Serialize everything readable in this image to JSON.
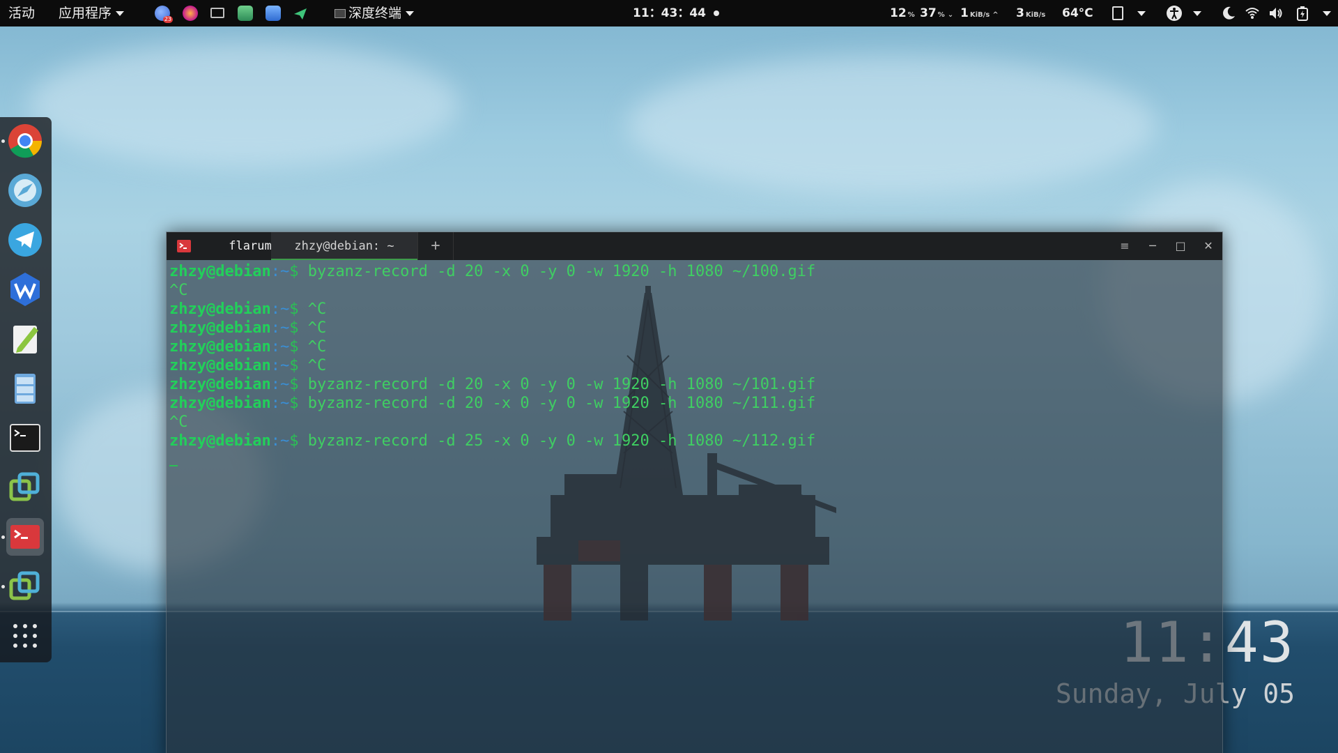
{
  "topbar": {
    "activities": "活动",
    "applications": "应用程序",
    "active_app": "深度终端",
    "clock": "11：43：44",
    "cpu": "12",
    "mem": "37",
    "percent": "%",
    "net_down": "1",
    "net_up": "3",
    "speed_unit": "KiB/s",
    "temp": "64°C",
    "badge_count": "23"
  },
  "dock": {
    "items": [
      {
        "name": "chrome",
        "running": true
      },
      {
        "name": "browser",
        "running": false
      },
      {
        "name": "telegram",
        "running": false
      },
      {
        "name": "wps",
        "running": false
      },
      {
        "name": "text-editor",
        "running": false
      },
      {
        "name": "file-manager",
        "running": false
      },
      {
        "name": "terminal",
        "running": false
      },
      {
        "name": "vmware-1",
        "running": false
      },
      {
        "name": "deepin-terminal",
        "running": true
      },
      {
        "name": "vmware-2",
        "running": true
      },
      {
        "name": "app-grid",
        "running": false
      }
    ],
    "colors": {
      "chrome_red": "#db4437",
      "chrome_green": "#0f9d58",
      "chrome_yellow": "#f4b400",
      "chrome_blue": "#4285f4",
      "telegram": "#3aa6e0",
      "wps": "#2e6fd9",
      "vmware": "#8bc34a",
      "deepin_terminal": "#d9383c"
    }
  },
  "terminal": {
    "tabs": [
      {
        "label": "flarum",
        "active": false
      },
      {
        "label": "zhzy@debian: ~",
        "active": true
      }
    ],
    "new_tab": "+",
    "controls": {
      "menu": "≡",
      "minimize": "─",
      "maximize": "□",
      "close": "✕"
    },
    "lines": [
      {
        "user": "zhzy@debian",
        "path": ":~",
        "symbol": "$ ",
        "command": "byzanz-record -d 20 -x 0 -y 0 -w 1920 -h 1080 ~/100.gif"
      },
      {
        "text": "^C"
      },
      {
        "user": "zhzy@debian",
        "path": ":~",
        "symbol": "$ ",
        "command": "^C"
      },
      {
        "user": "zhzy@debian",
        "path": ":~",
        "symbol": "$ ",
        "command": "^C"
      },
      {
        "user": "zhzy@debian",
        "path": ":~",
        "symbol": "$ ",
        "command": "^C"
      },
      {
        "user": "zhzy@debian",
        "path": ":~",
        "symbol": "$ ",
        "command": "^C"
      },
      {
        "user": "zhzy@debian",
        "path": ":~",
        "symbol": "$ ",
        "command": "byzanz-record -d 20 -x 0 -y 0 -w 1920 -h 1080 ~/101.gif"
      },
      {
        "user": "zhzy@debian",
        "path": ":~",
        "symbol": "$ ",
        "command": "byzanz-record -d 20 -x 0 -y 0 -w 1920 -h 1080 ~/111.gif"
      },
      {
        "text": "^C"
      },
      {
        "user": "zhzy@debian",
        "path": ":~",
        "symbol": "$ ",
        "command": "byzanz-record -d 25 -x 0 -y 0 -w 1920 -h 1080 ~/112.gif"
      }
    ],
    "colors": {
      "prompt_user": "#22d05a",
      "prompt_path": "#3a8fd6",
      "command": "#3fcf62"
    }
  },
  "desktop_clock": {
    "time": "11:43",
    "date": "Sunday, July 05"
  }
}
